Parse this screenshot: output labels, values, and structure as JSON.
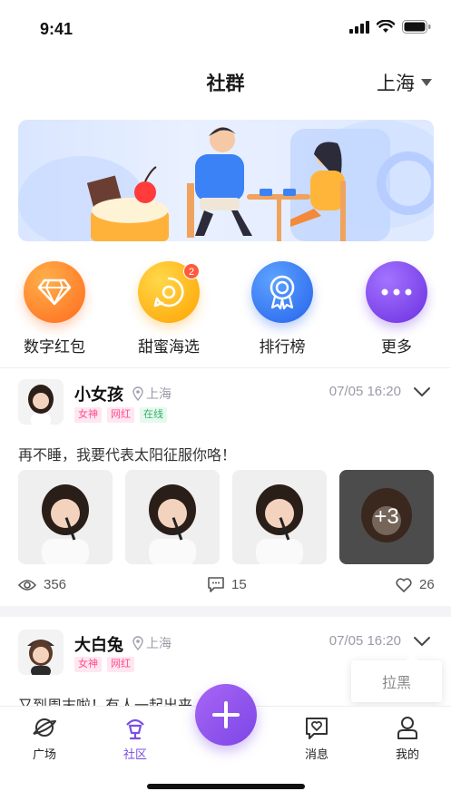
{
  "status": {
    "time": "9:41"
  },
  "nav": {
    "title": "社群",
    "city": "上海"
  },
  "quick_actions": [
    {
      "label": "数字红包",
      "icon": "diamond-icon",
      "color": "#ff7b2e"
    },
    {
      "label": "甜蜜海选",
      "icon": "chat-target-icon",
      "color": "#ffb800",
      "badge": "2"
    },
    {
      "label": "排行榜",
      "icon": "medal-icon",
      "color": "#3a7bff"
    },
    {
      "label": "更多",
      "icon": "more-dots-icon",
      "color": "#7b3fe8"
    }
  ],
  "posts": [
    {
      "name": "小女孩",
      "location": "上海",
      "time": "07/05  16:20",
      "tags": [
        "女神",
        "网红",
        "在线"
      ],
      "text": "再不睡，我要代表太阳征服你咯！",
      "more_photos": "+3",
      "views": "356",
      "comments": "15",
      "likes": "26"
    },
    {
      "name": "大白兔",
      "location": "上海",
      "time": "07/05  16:20",
      "tags": [
        "女神",
        "网红"
      ],
      "text": "又到周末啦！有人一起出来"
    }
  ],
  "dropdown": {
    "block_label": "拉黑"
  },
  "tabbar": [
    {
      "label": "广场",
      "icon": "planet-icon"
    },
    {
      "label": "社区",
      "icon": "community-icon",
      "active": true
    },
    {
      "label": "消息",
      "icon": "message-icon"
    },
    {
      "label": "我的",
      "icon": "profile-icon"
    }
  ],
  "colors": {
    "accent": "#7a4ee5",
    "tag_pink": "#ff4f8d",
    "tag_green": "#2fb46a"
  }
}
